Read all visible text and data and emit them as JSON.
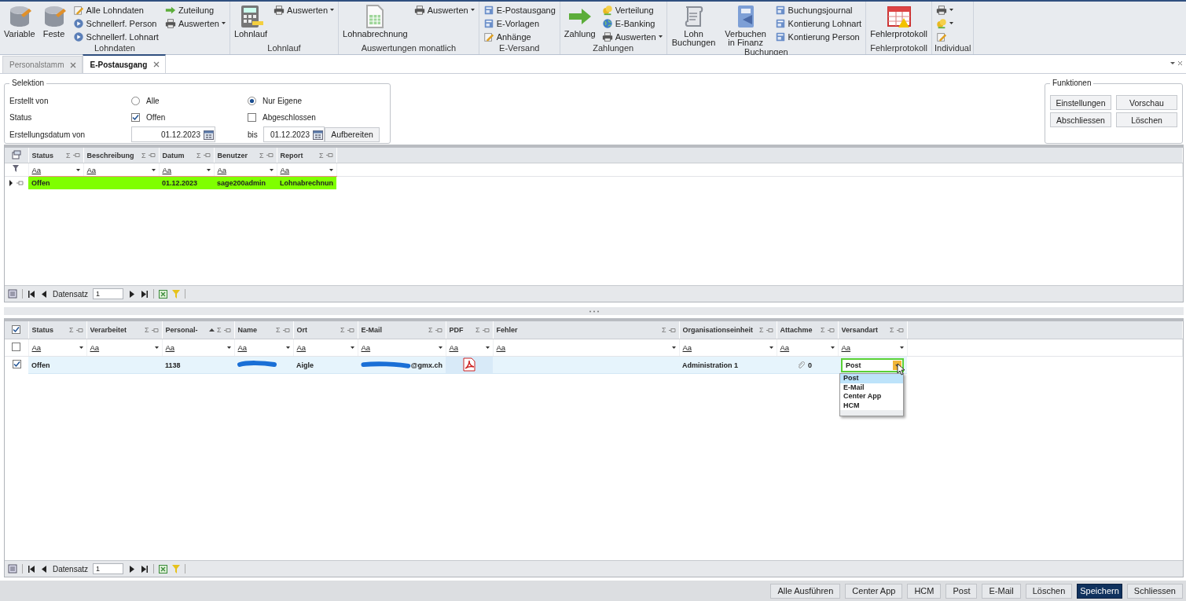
{
  "ribbon": {
    "groups": [
      {
        "label": "Lohndaten",
        "columns": [
          {
            "kind": "large",
            "label": "Variable"
          },
          {
            "kind": "large",
            "label": "Feste"
          },
          {
            "kind": "stack",
            "items": [
              {
                "label": "Alle Lohndaten",
                "dropdown": false
              },
              {
                "label": "Schnellerf. Person",
                "dropdown": false
              },
              {
                "label": "Schnellerf. Lohnart",
                "dropdown": false
              }
            ]
          },
          {
            "kind": "stack",
            "items": [
              {
                "label": "Zuteilung",
                "dropdown": false
              },
              {
                "label": "Auswerten",
                "dropdown": true
              }
            ]
          }
        ]
      },
      {
        "label": "Lohnlauf",
        "columns": [
          {
            "kind": "large",
            "label": "Lohnlauf"
          },
          {
            "kind": "stack",
            "items": [
              {
                "label": "Auswerten",
                "dropdown": true
              }
            ]
          }
        ]
      },
      {
        "label": "Auswertungen monatlich",
        "columns": [
          {
            "kind": "large",
            "label": "Lohnabrechnung"
          },
          {
            "kind": "stack",
            "items": [
              {
                "label": "Auswerten",
                "dropdown": true
              }
            ]
          }
        ]
      },
      {
        "label": "E-Versand",
        "columns": [
          {
            "kind": "stack",
            "items": [
              {
                "label": "E-Postausgang",
                "dropdown": false
              },
              {
                "label": "E-Vorlagen",
                "dropdown": false
              },
              {
                "label": "Anhänge",
                "dropdown": false
              }
            ]
          }
        ]
      },
      {
        "label": "Zahlungen",
        "columns": [
          {
            "kind": "large",
            "label": "Zahlung"
          },
          {
            "kind": "stack",
            "items": [
              {
                "label": "Verteilung",
                "dropdown": false
              },
              {
                "label": "E-Banking",
                "dropdown": false
              },
              {
                "label": "Auswerten",
                "dropdown": true
              }
            ]
          }
        ]
      },
      {
        "label": "Buchungen",
        "columns": [
          {
            "kind": "large",
            "label": "Lohn Buchungen"
          },
          {
            "kind": "large",
            "label": "Verbuchen in Finanz"
          },
          {
            "kind": "stack",
            "items": [
              {
                "label": "Buchungsjournal",
                "dropdown": false
              },
              {
                "label": "Kontierung Lohnart",
                "dropdown": false
              },
              {
                "label": "Kontierung Person",
                "dropdown": false
              }
            ]
          }
        ]
      },
      {
        "label": "Fehlerprotokoll",
        "columns": [
          {
            "kind": "large",
            "label": "Fehlerprotokoll"
          }
        ]
      },
      {
        "label": "Individual",
        "columns": [
          {
            "kind": "stack",
            "items": [
              {
                "dropdown": true
              },
              {
                "dropdown": true
              },
              {
                "dropdown": false
              }
            ]
          }
        ]
      }
    ]
  },
  "tabs": [
    {
      "label": "Personalstamm",
      "selected": false
    },
    {
      "label": "E-Postausgang",
      "selected": true
    }
  ],
  "selektion": {
    "title": "Selektion",
    "erstellt_von": {
      "label": "Erstellt von",
      "options": [
        {
          "label": "Alle",
          "selected": false
        },
        {
          "label": "Nur Eigene",
          "selected": true
        }
      ]
    },
    "status": {
      "label": "Status",
      "options": [
        {
          "label": "Offen",
          "checked": true
        },
        {
          "label": "Abgeschlossen",
          "checked": false
        }
      ]
    },
    "datum": {
      "label": "Erstellungsdatum von",
      "from": "01.12.2023",
      "to_label": "bis",
      "to": "01.12.2023",
      "button": "Aufbereiten"
    }
  },
  "funktionen": {
    "title": "Funktionen",
    "buttons": [
      "Einstellungen",
      "Vorschau",
      "Abschliessen",
      "Löschen"
    ]
  },
  "grid_top": {
    "columns": [
      {
        "label": "Status",
        "sum": "Σ",
        "filter": "Aa",
        "sorted": false
      },
      {
        "label": "Beschreibung",
        "sum": "Σ",
        "filter": "Aa",
        "sorted": false
      },
      {
        "label": "Datum",
        "sum": "Σ",
        "filter": "Aa",
        "sorted": false
      },
      {
        "label": "Benutzer",
        "sum": "Σ",
        "filter": "Aa",
        "sorted": false
      },
      {
        "label": "Report",
        "sum": "Σ",
        "filter": "Aa",
        "sorted": false
      }
    ],
    "rows": [
      {
        "selected": true,
        "cells": [
          {
            "kind": "text",
            "text": "Offen"
          },
          {
            "kind": "empty"
          },
          {
            "kind": "text",
            "text": "01.12.2023"
          },
          {
            "kind": "text",
            "text": "sage200admin"
          },
          {
            "kind": "text",
            "text": "Lohnabrechnun"
          }
        ]
      }
    ],
    "navigator": {
      "label": "Datensatz",
      "value": "1"
    }
  },
  "grid_bottom": {
    "header_checked": true,
    "filter_checked": false,
    "columns": [
      {
        "label": "Status",
        "sum": "Σ",
        "filter": "Aa",
        "sorted": false
      },
      {
        "label": "Verarbeitet",
        "sum": "Σ",
        "filter": "Aa",
        "sorted": false
      },
      {
        "label": "Personal-",
        "sum": "Σ",
        "filter": "Aa",
        "sorted": true
      },
      {
        "label": "Name",
        "sum": "Σ",
        "filter": "Aa",
        "sorted": false
      },
      {
        "label": "Ort",
        "sum": "Σ",
        "filter": "Aa",
        "sorted": false
      },
      {
        "label": "E-Mail",
        "sum": "Σ",
        "filter": "Aa",
        "sorted": false
      },
      {
        "label": "PDF",
        "sum": "Σ",
        "filter": "Aa",
        "sorted": false
      },
      {
        "label": "Fehler",
        "sum": "Σ",
        "filter": "Aa",
        "sorted": false
      },
      {
        "label": "Organisationseinheit",
        "sum": "Σ",
        "filter": "Aa",
        "sorted": false
      },
      {
        "label": "Attachme",
        "sum": "Σ",
        "filter": "Aa",
        "sorted": false
      },
      {
        "label": "Versandart",
        "sum": "Σ",
        "filter": "Aa",
        "sorted": false
      }
    ],
    "rows": [
      {
        "checked": true,
        "cells": [
          {
            "kind": "text",
            "text": "Offen"
          },
          {
            "kind": "empty"
          },
          {
            "kind": "text",
            "text": "1138"
          },
          {
            "kind": "redacted"
          },
          {
            "kind": "text",
            "text": "Aigle"
          },
          {
            "kind": "email",
            "text": "@gmx.ch"
          },
          {
            "kind": "pdf"
          },
          {
            "kind": "empty"
          },
          {
            "kind": "text",
            "text": "Administration 1"
          },
          {
            "kind": "attachment",
            "text": "0"
          },
          {
            "kind": "select",
            "value": "Post",
            "options": [
              {
                "label": "Post",
                "selected": true
              },
              {
                "label": "E-Mail",
                "selected": false
              },
              {
                "label": "Center App",
                "selected": false
              },
              {
                "label": "HCM",
                "selected": false
              }
            ]
          }
        ]
      }
    ],
    "navigator": {
      "label": "Datensatz",
      "value": "1"
    }
  },
  "footer_buttons": [
    {
      "label": "Alle Ausführen",
      "primary": false
    },
    {
      "label": "Center App",
      "primary": false
    },
    {
      "label": "HCM",
      "primary": false
    },
    {
      "label": "Post",
      "primary": false
    },
    {
      "label": "E-Mail",
      "primary": false
    },
    {
      "label": "Löschen",
      "primary": false
    },
    {
      "label": "Speichern",
      "primary": true
    },
    {
      "label": "Schliessen",
      "primary": false
    }
  ]
}
